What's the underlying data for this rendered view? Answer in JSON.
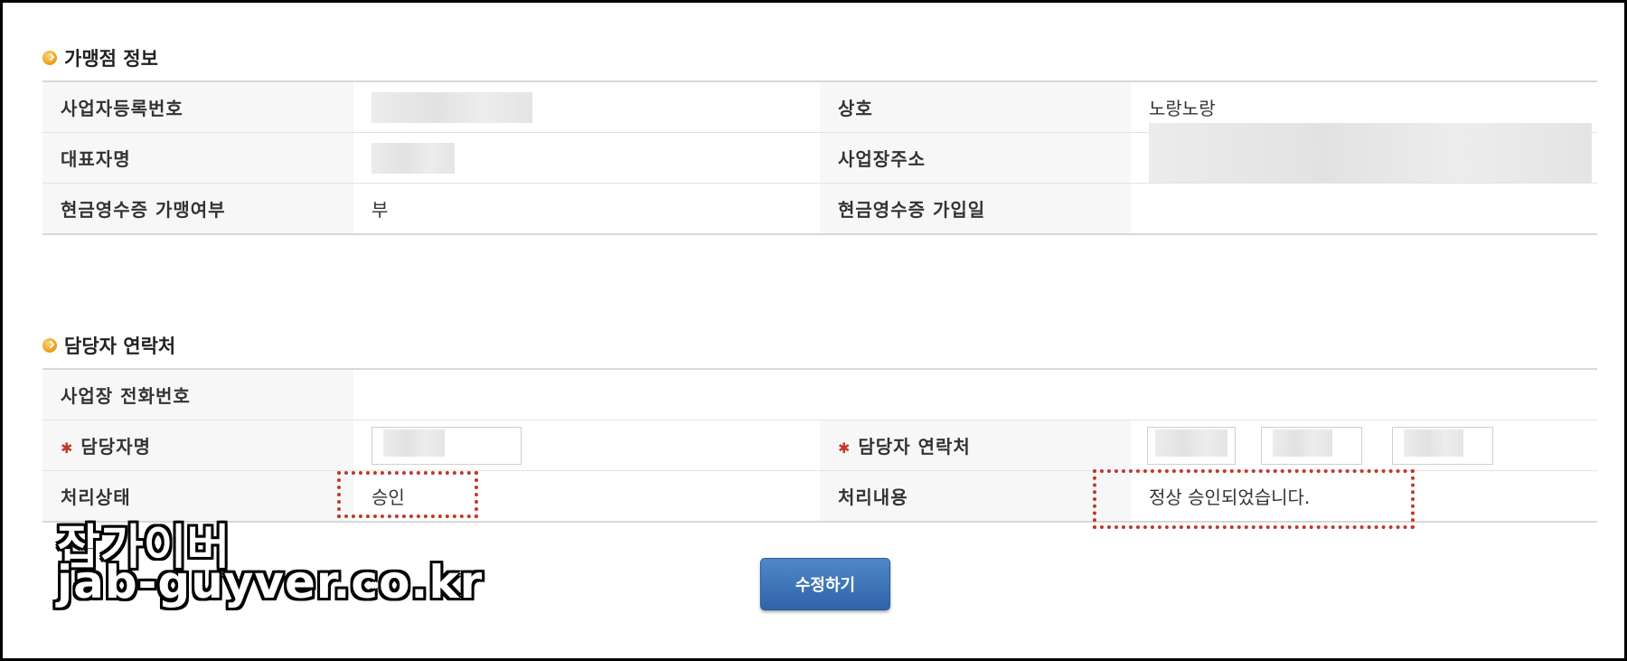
{
  "merchant_section": {
    "title": "가맹점 정보",
    "rows": [
      {
        "label1": "사업자등록번호",
        "value1": "",
        "label2": "상호",
        "value2": "노랑노랑"
      },
      {
        "label1": "대표자명",
        "value1": "",
        "label2": "사업장주소",
        "value2": ""
      },
      {
        "label1": "현금영수증 가맹여부",
        "value1": "부",
        "label2": "현금영수증 가입일",
        "value2": ""
      }
    ]
  },
  "contact_section": {
    "title": "담당자 연락처",
    "phone_label": "사업장 전화번호",
    "phone_value": "",
    "manager_name_label": "담당자명",
    "manager_contact_label": "담당자 연락처",
    "status_label": "처리상태",
    "status_value": "승인",
    "result_label": "처리내용",
    "result_value": "정상 승인되었습니다."
  },
  "actions": {
    "edit_button": "수정하기"
  },
  "watermark": {
    "line1": "잡가이버",
    "line2": "jab-guyver.co.kr"
  },
  "colors": {
    "button_blue": "#3a72b8",
    "highlight_red": "#c0392b",
    "bullet_orange": "#f0a21e"
  }
}
